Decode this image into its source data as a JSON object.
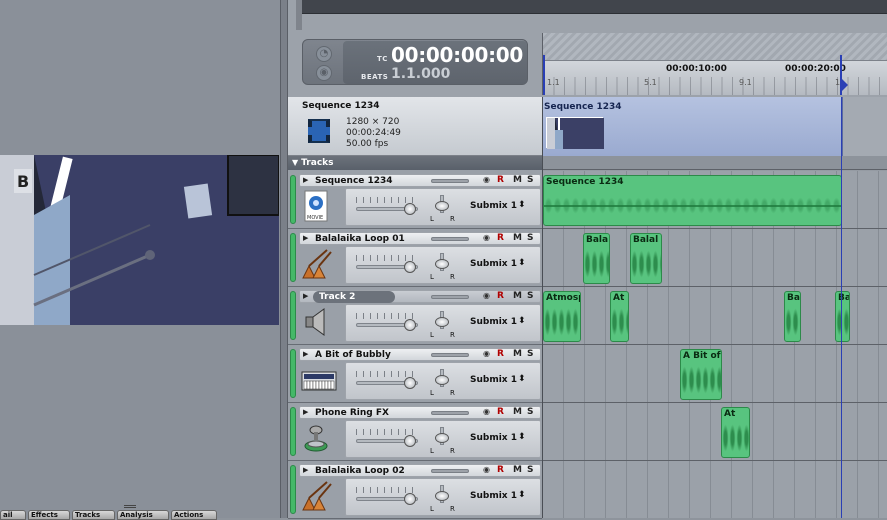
{
  "bottom_tabs": [
    "ail",
    "Effects",
    "Tracks",
    "Analysis",
    "Actions"
  ],
  "time_display": {
    "tc_label": "TC",
    "tc_value": "00:00:00:00",
    "beats_label": "BEATS",
    "beats_value": "1.1.000"
  },
  "ruler": {
    "time_labels": [
      "00:00:10:00",
      "00:00:20:00"
    ],
    "beat_labels": [
      "1.1",
      "5.1",
      "9.1",
      "1"
    ]
  },
  "sequence": {
    "name": "Sequence 1234",
    "resolution": "1280 × 720",
    "duration": "00:00:24:49",
    "fps": "50.00 fps",
    "preview_title": "Sequence 1234"
  },
  "tracks_header": "Tracks",
  "tracks": [
    {
      "name": "Sequence 1234",
      "icon": "movie-file-icon",
      "submix": "Submix 1",
      "selected": false,
      "clips": [
        {
          "label": "Sequence 1234"
        }
      ]
    },
    {
      "name": "Balalaika Loop 01",
      "icon": "balalaika-icon",
      "submix": "Submix 1",
      "selected": false,
      "clips": [
        {
          "label": "Bala"
        },
        {
          "label": "Balal"
        }
      ]
    },
    {
      "name": "Track 2",
      "icon": "speaker-icon",
      "submix": "Submix 1",
      "selected": true,
      "clips": [
        {
          "label": "Atmosp"
        },
        {
          "label": "At"
        },
        {
          "label": "Ba"
        },
        {
          "label": "Ba"
        }
      ]
    },
    {
      "name": "A Bit of Bubbly",
      "icon": "synth-keyboard-icon",
      "submix": "Submix 1",
      "selected": false,
      "clips": [
        {
          "label": "A Bit of"
        }
      ]
    },
    {
      "name": "Phone Ring FX",
      "icon": "phone-fx-icon",
      "submix": "Submix 1",
      "selected": false,
      "clips": [
        {
          "label": "At"
        }
      ]
    },
    {
      "name": "Balalaika Loop 02",
      "icon": "balalaika-icon",
      "submix": "Submix 1",
      "selected": false,
      "clips": []
    }
  ],
  "buttons": {
    "record": "R",
    "mute": "M",
    "solo": "S"
  },
  "pan_labels": {
    "left": "L",
    "right": "R"
  },
  "colors": {
    "clip_green": "#58c47f",
    "playhead_blue": "#2a3fb5",
    "record_red": "#b00000"
  }
}
